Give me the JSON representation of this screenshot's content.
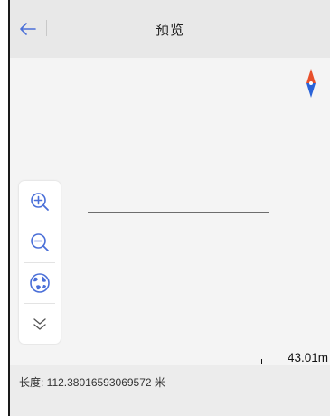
{
  "header": {
    "back_icon": "arrow-left-icon",
    "title": "预览"
  },
  "map": {
    "compass_icon": "compass-icon",
    "zoom_controls": {
      "zoom_in_icon": "zoom-in-icon",
      "zoom_out_icon": "zoom-out-icon",
      "globe_icon": "globe-icon",
      "collapse_icon": "chevron-double-down-icon"
    },
    "scale_label": "43.01m"
  },
  "footer": {
    "length_text": "长度:  112.38016593069572 米"
  },
  "colors": {
    "accent": "#4a6fd8",
    "compass_north": "#e8502b",
    "compass_south": "#2b63d8",
    "header_bg": "#e8e8e8",
    "map_bg": "#f4f4f4",
    "track": "#6d6d6d"
  }
}
